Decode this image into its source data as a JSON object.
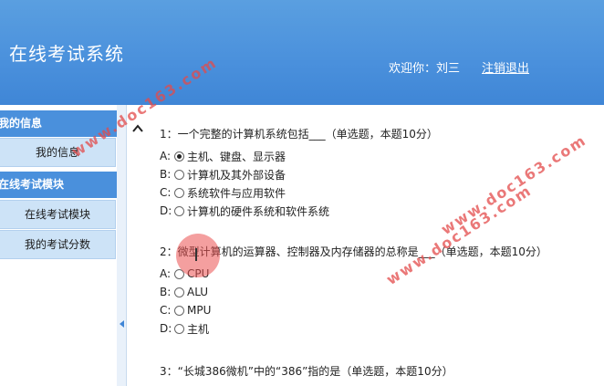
{
  "header": {
    "title": "在线考试系统",
    "welcome": "欢迎你：刘三",
    "logout": "注销退出"
  },
  "sidebar": {
    "sections": [
      {
        "title": "我的信息",
        "items": [
          "我的信息"
        ]
      },
      {
        "title": "在线考试模块",
        "items": [
          "在线考试模块",
          "我的考试分数"
        ]
      }
    ]
  },
  "questions": [
    {
      "title": "1：一个完整的计算机系统包括___（单选题，本题10分）",
      "options": [
        {
          "letter": "A:",
          "text": "主机、键盘、显示器",
          "checked": true
        },
        {
          "letter": "B:",
          "text": "计算机及其外部设备",
          "checked": false
        },
        {
          "letter": "C:",
          "text": "系统软件与应用软件",
          "checked": false
        },
        {
          "letter": "D:",
          "text": "计算机的硬件系统和软件系统",
          "checked": false
        }
      ]
    },
    {
      "title": "2：微型计算机的运算器、控制器及内存储器的总称是___（单选题，本题10分）",
      "options": [
        {
          "letter": "A:",
          "text": "CPU",
          "checked": false
        },
        {
          "letter": "B:",
          "text": "ALU",
          "checked": false
        },
        {
          "letter": "C:",
          "text": "MPU",
          "checked": false
        },
        {
          "letter": "D:",
          "text": "主机",
          "checked": false
        }
      ]
    },
    {
      "title": "3：“长城386微机”中的“386”指的是（单选题，本题10分）"
    }
  ],
  "watermark": "www.doc163.com",
  "colors": {
    "header": "#4a90dc",
    "nav_item": "#cde3f7",
    "watermark": "#e34b4b"
  }
}
